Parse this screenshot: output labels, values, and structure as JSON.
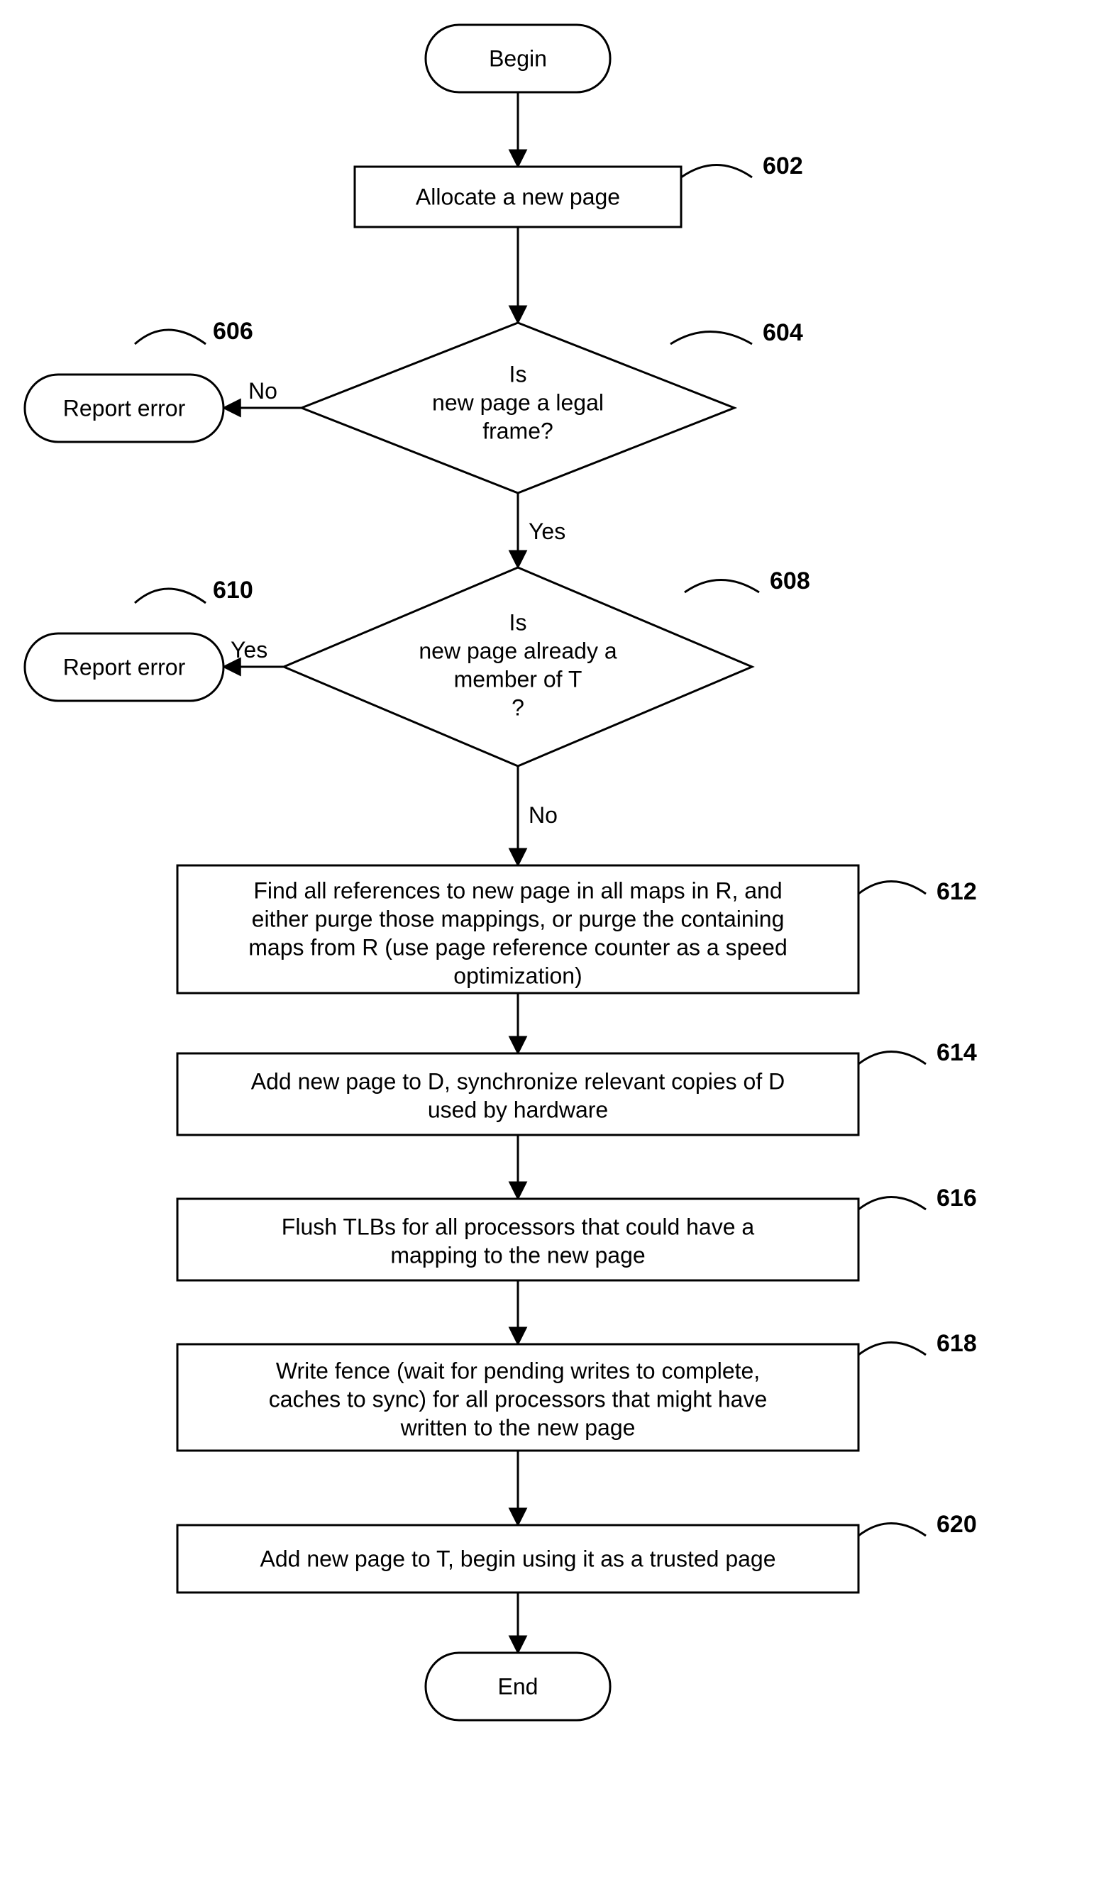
{
  "nodes": {
    "begin": "Begin",
    "end": "End",
    "n602": "Allocate a new page",
    "n604_l1": "Is",
    "n604_l2": "new page a legal",
    "n604_l3": "frame?",
    "n606": "Report error",
    "n608_l1": "Is",
    "n608_l2": "new page already a",
    "n608_l3": "member of T",
    "n608_l4": "?",
    "n610": "Report error",
    "n612_l1": "Find all references to new page in all maps in R, and",
    "n612_l2": "either purge those mappings, or purge the containing",
    "n612_l3": "maps from R (use page reference counter as a speed",
    "n612_l4": "optimization)",
    "n614_l1": "Add new page to D, synchronize relevant copies of D",
    "n614_l2": "used by hardware",
    "n616_l1": "Flush TLBs for all processors that could have a",
    "n616_l2": "mapping to the new page",
    "n618_l1": "Write fence (wait for pending writes to complete,",
    "n618_l2": "caches to sync) for all processors that might have",
    "n618_l3": "written to the new page",
    "n620": "Add new page to T, begin using it as a trusted page"
  },
  "edges": {
    "no": "No",
    "yes": "Yes"
  },
  "labels": {
    "l602": "602",
    "l604": "604",
    "l606": "606",
    "l608": "608",
    "l610": "610",
    "l612": "612",
    "l614": "614",
    "l616": "616",
    "l618": "618",
    "l620": "620"
  }
}
